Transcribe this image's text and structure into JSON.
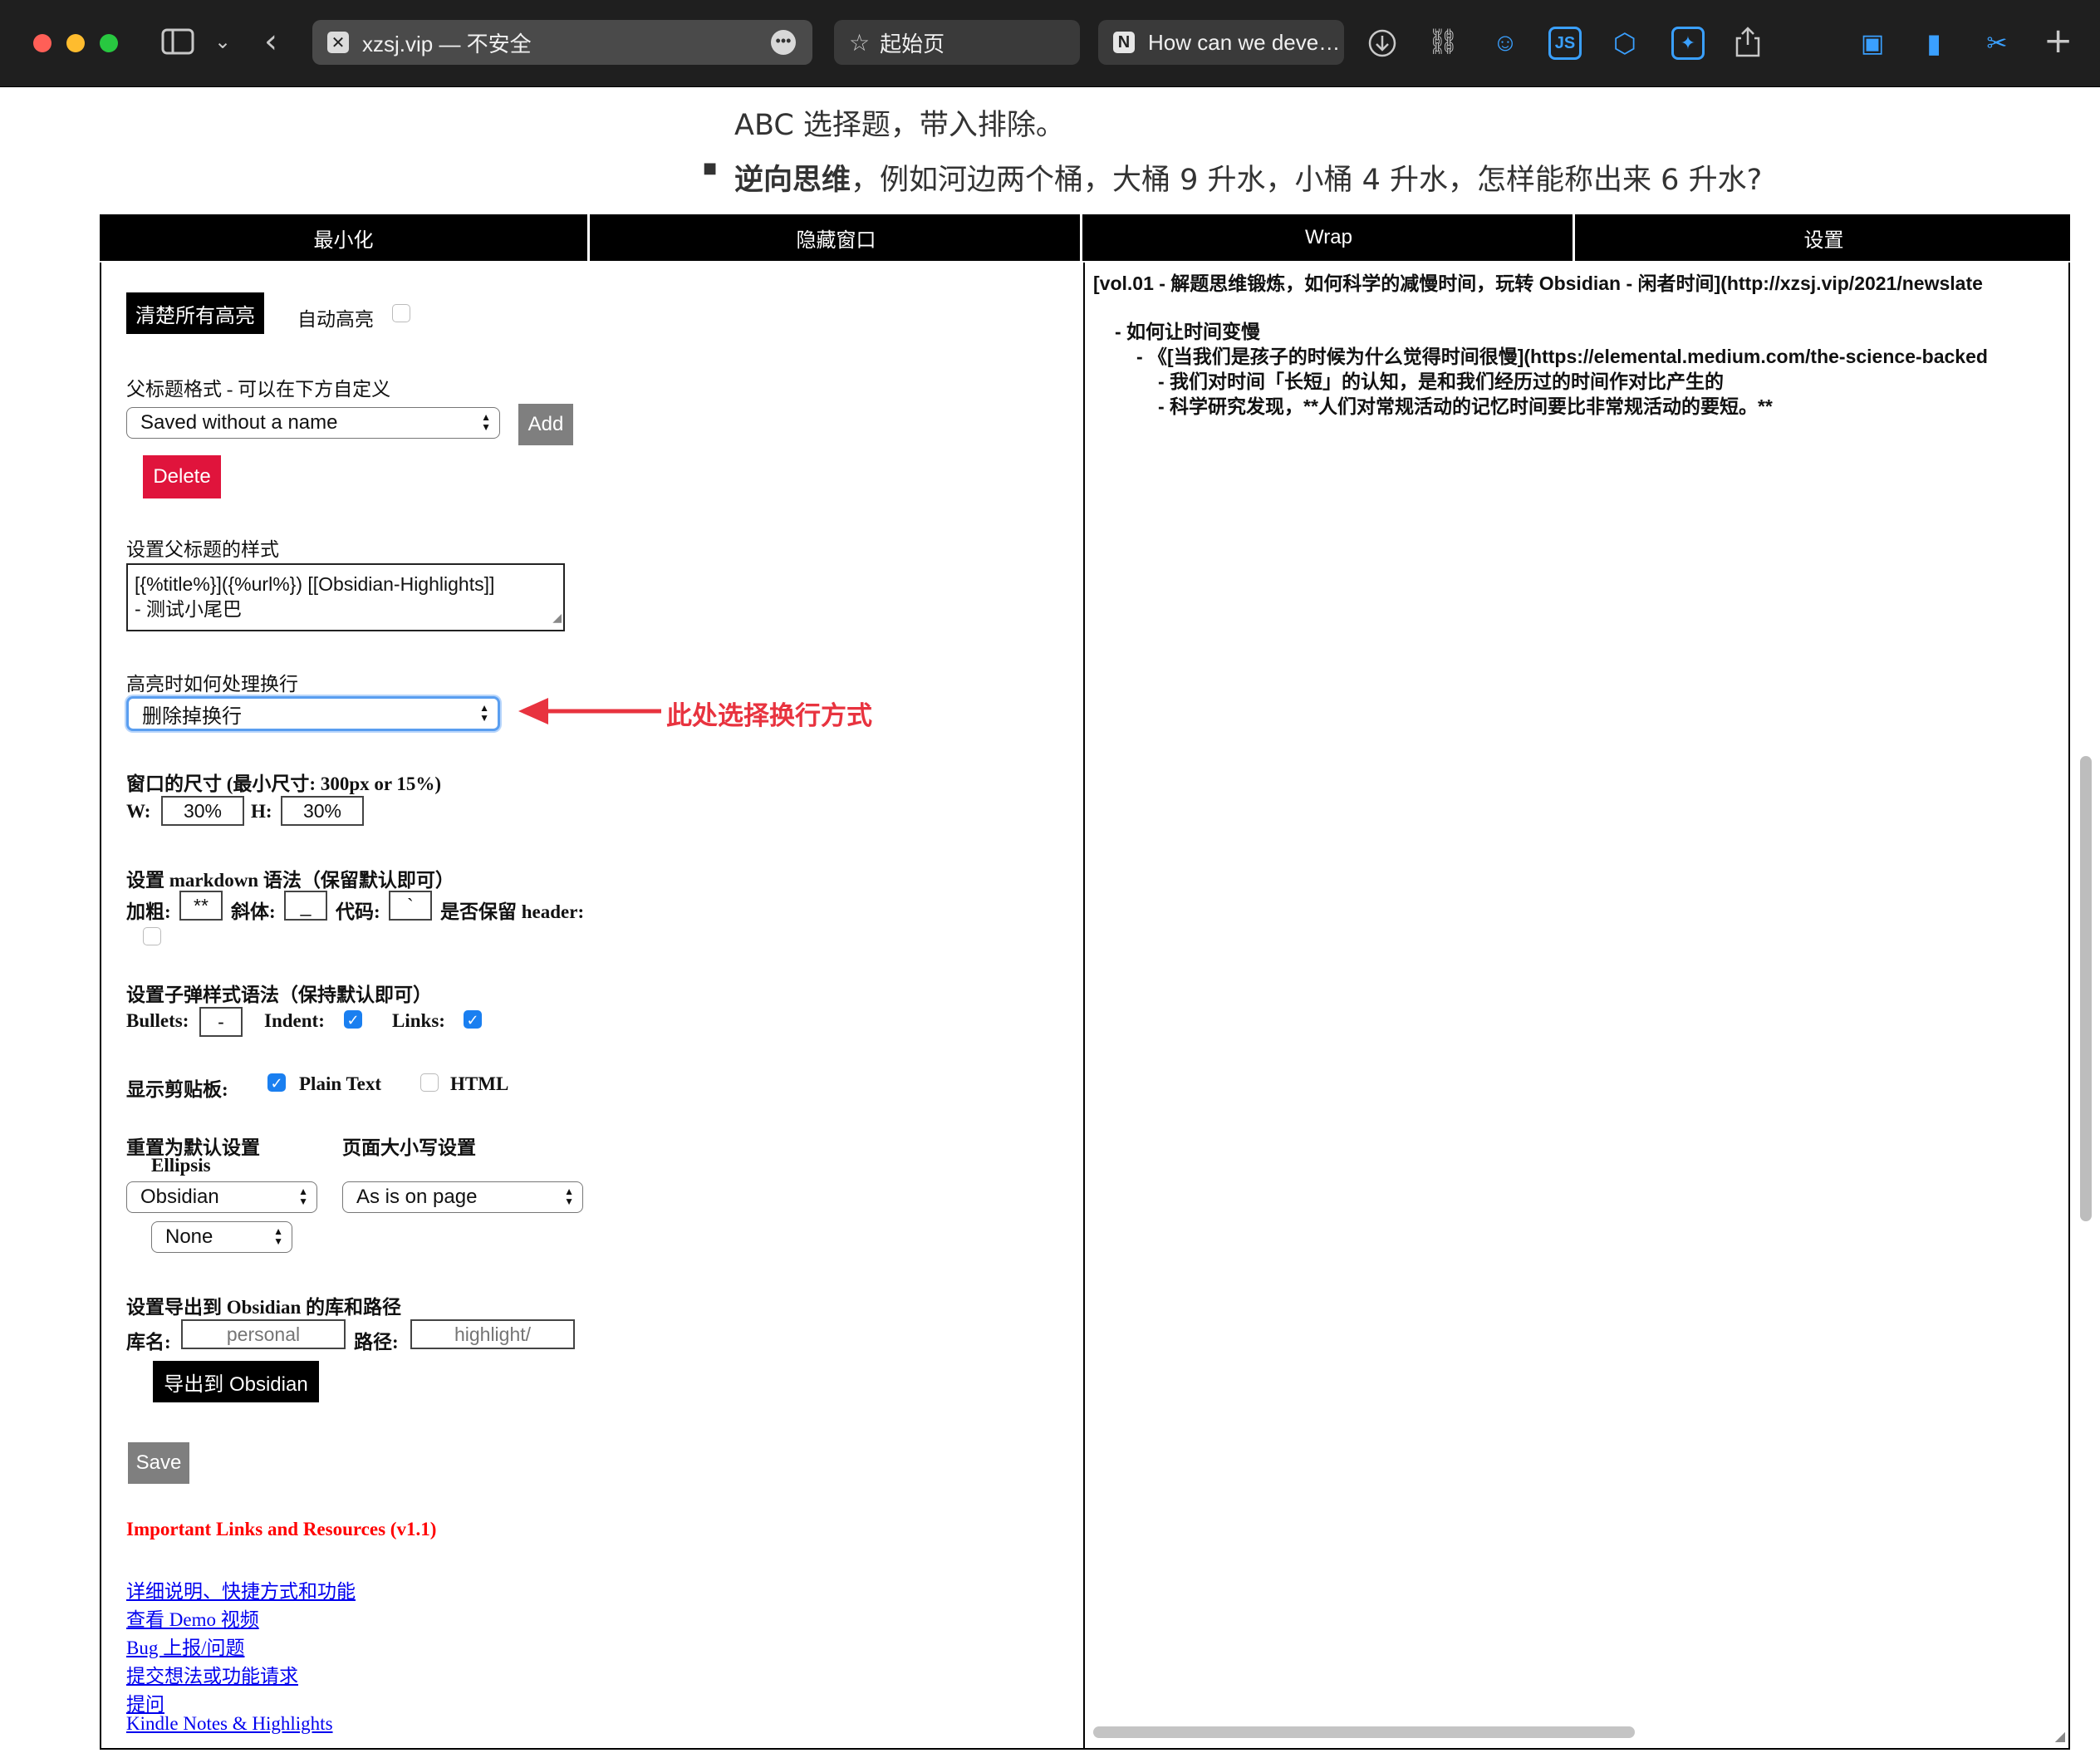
{
  "browser": {
    "tabs": {
      "active_url": "xzsj.vip — 不安全",
      "tab2": "起始页",
      "tab3": "How can we deve…",
      "tab3_favicon": "N"
    },
    "extensions": {
      "js_label": "JS"
    }
  },
  "article": {
    "line1": "ABC 选择题，带入排除。",
    "bullet_bold": "逆向思维",
    "bullet_rest": "，例如河边两个桶，大桶 9 升水，小桶 4 升水，怎样能称出来 6 升水?"
  },
  "menubar": {
    "minimize": "最小化",
    "hide": "隐藏窗口",
    "wrap": "Wrap",
    "settings": "设置"
  },
  "settings": {
    "clear_highlights": "清楚所有高亮",
    "auto_highlight": "自动高亮",
    "parent_title_format": "父标题格式 - 可以在下方自定义",
    "saved_select": "Saved without a name",
    "add": "Add",
    "delete": "Delete",
    "parent_style_label": "设置父标题的样式",
    "parent_style_value_1": "[{%title%}]({%url%}) [[Obsidian-Highlights]]",
    "parent_style_value_2": "- 测试小尾巴",
    "newline_label": "高亮时如何处理换行",
    "newline_select": "删除掉换行",
    "annotation": "此处选择换行方式",
    "size_label": "窗口的尺寸 (最小尺寸: 300px or 15%)",
    "w_label": "W:",
    "w_value": "30%",
    "h_label": "H:",
    "h_value": "30%",
    "markdown_label": "设置 markdown 语法（保留默认即可）",
    "bold_label": "加粗:",
    "bold_value": "**",
    "italic_label": "斜体:",
    "italic_value": "_",
    "code_label": "代码:",
    "code_value": "`",
    "keep_header_label": "是否保留 header:",
    "bullet_syntax_label": "设置子弹样式语法（保持默认即可）",
    "bullets_label": "Bullets:",
    "bullets_value": "-",
    "indent_label": "Indent:",
    "links_label": "Links:",
    "clipboard_label": "显示剪贴板:",
    "plain_text": "Plain Text",
    "html": "HTML",
    "reset_label": "重置为默认设置",
    "ellipsis_label": "Ellipsis",
    "case_label": "页面大小写设置",
    "reset_select": "Obsidian",
    "case_select": "As is on page",
    "ellipsis_select": "None",
    "export_label": "设置导出到 Obsidian 的库和路径",
    "vault_label": "库名:",
    "vault_placeholder": "personal",
    "path_label": "路径:",
    "path_placeholder": "highlight/",
    "export_button": "导出到 Obsidian",
    "save": "Save",
    "resources_title": "Important Links and Resources (v1.1)",
    "links": [
      "详细说明、快捷方式和功能",
      "查看 Demo 视频",
      "Bug 上报/问题",
      "提交想法或功能请求",
      "提问",
      "Kindle Notes & Highlights"
    ]
  },
  "output": {
    "line1": "[vol.01 - 解题思维锻炼，如何科学的减慢时间，玩转 Obsidian - 闲者时间](http://xzsj.vip/2021/newslate",
    "line2": "- 如何让时间变慢",
    "line3": "- 《[当我们是孩子的时候为什么觉得时间很慢](https://elemental.medium.com/the-science-backed",
    "line4": "- 我们对时间「长短」的认知，是和我们经历过的时间作对比产生的",
    "line5": "- 科学研究发现，**人们对常规活动的记忆时间要比非常规活动的要短。**"
  },
  "colors": {
    "delete_red": "#e0143c",
    "annotation_red": "#e8333f",
    "resources_red": "#ff0000",
    "checkbox_blue": "#1a7ff0"
  }
}
